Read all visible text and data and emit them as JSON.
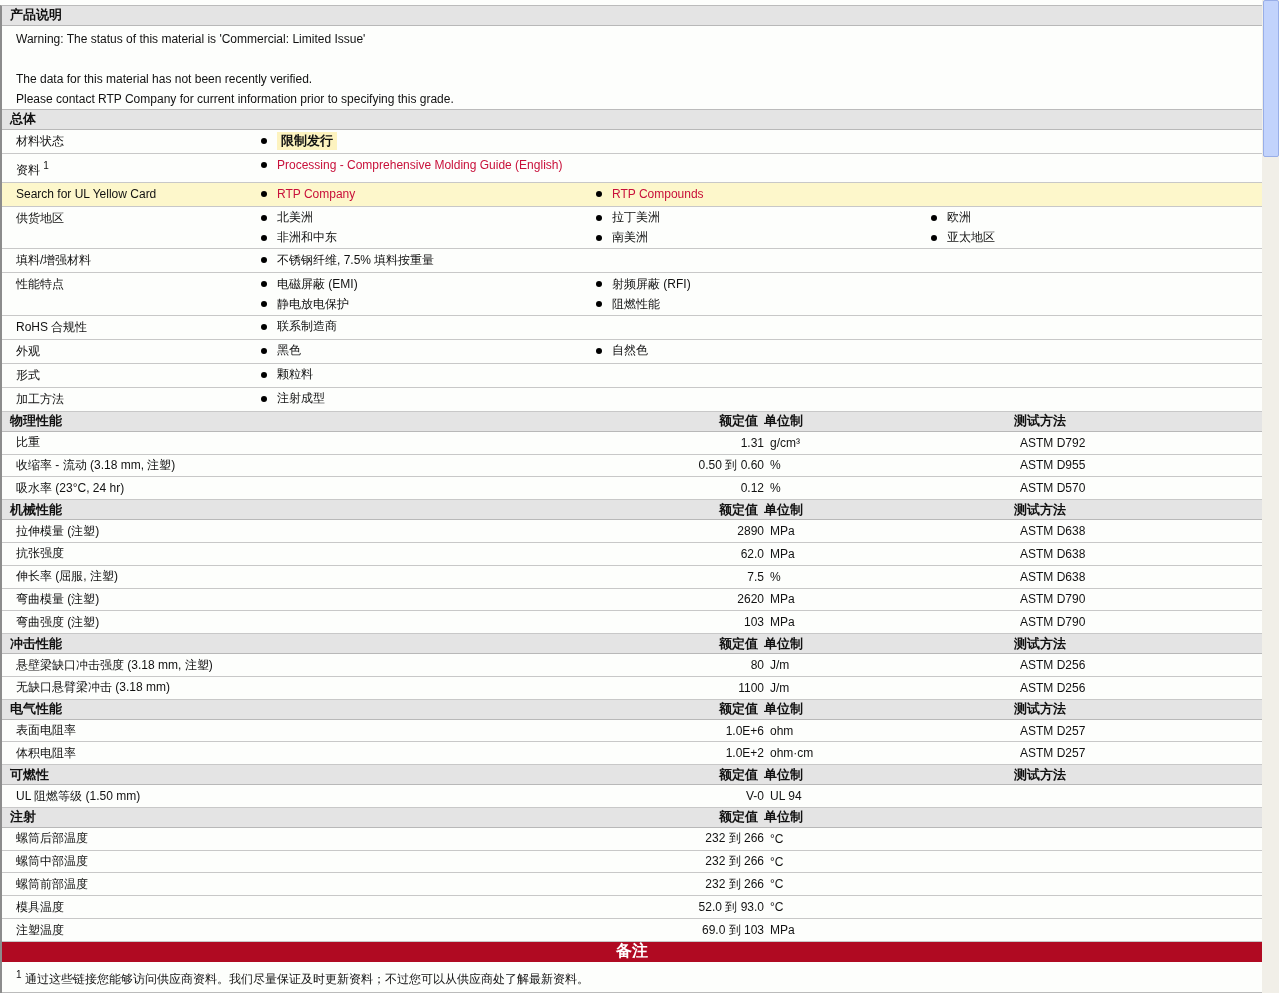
{
  "description": {
    "title": "产品说明",
    "paragraphs": [
      [
        "Warning: The status of this material is 'Commercial: Limited Issue'"
      ],
      [
        "The data for this material has not been recently verified.",
        "Please contact RTP Company for current information prior to specifying this grade."
      ]
    ]
  },
  "general": {
    "title": "总体",
    "rows": [
      {
        "label": "材料状态",
        "highlighted": false,
        "items": [
          {
            "kind": "status",
            "text": "限制发行"
          }
        ]
      },
      {
        "label": "资料 $^{1}$",
        "highlighted": false,
        "items": [
          {
            "kind": "link",
            "text": "Processing - Comprehensive Molding Guide (English)"
          }
        ]
      },
      {
        "label": "Search for UL Yellow Card",
        "highlighted": true,
        "items": [
          {
            "kind": "link",
            "text": "RTP Company"
          },
          {
            "kind": "link",
            "text": "RTP Compounds"
          }
        ]
      },
      {
        "label": "供货地区",
        "highlighted": false,
        "items": [
          {
            "kind": "text",
            "text": "北美洲"
          },
          {
            "kind": "text",
            "text": "拉丁美洲"
          },
          {
            "kind": "text",
            "text": "欧洲"
          },
          {
            "kind": "text",
            "text": "非洲和中东"
          },
          {
            "kind": "text",
            "text": "南美洲"
          },
          {
            "kind": "text",
            "text": "亚太地区"
          }
        ]
      },
      {
        "label": "填料/增强材料",
        "highlighted": false,
        "items": [
          {
            "kind": "text",
            "text": "不锈钢纤维, 7.5% 填料按重量"
          }
        ]
      },
      {
        "label": "性能特点",
        "highlighted": false,
        "items": [
          {
            "kind": "text",
            "text": "电磁屏蔽 (EMI)"
          },
          {
            "kind": "text",
            "text": "射频屏蔽 (RFI)"
          },
          {
            "kind": "break"
          },
          {
            "kind": "text",
            "text": "静电放电保护"
          },
          {
            "kind": "text",
            "text": "阻燃性能"
          }
        ]
      },
      {
        "label": "RoHS 合规性",
        "highlighted": false,
        "items": [
          {
            "kind": "text",
            "text": "联系制造商"
          }
        ]
      },
      {
        "label": "外观",
        "highlighted": false,
        "items": [
          {
            "kind": "text",
            "text": "黑色"
          },
          {
            "kind": "text",
            "text": "自然色"
          }
        ]
      },
      {
        "label": "形式",
        "highlighted": false,
        "items": [
          {
            "kind": "text",
            "text": "颗粒料"
          }
        ]
      },
      {
        "label": "加工方法",
        "highlighted": false,
        "items": [
          {
            "kind": "text",
            "text": "注射成型"
          }
        ]
      }
    ]
  },
  "property_sections": [
    {
      "title": "物理性能",
      "headers": {
        "value": "额定值",
        "unit": "单位制",
        "method": "测试方法"
      },
      "rows": [
        {
          "name": "比重",
          "value": "1.31",
          "unit": "g/cm³",
          "method": "ASTM D792"
        },
        {
          "name": "收缩率  - 流动 (3.18 mm, 注塑)",
          "value": "0.50 到  0.60",
          "unit": "%",
          "method": "ASTM D955"
        },
        {
          "name": "吸水率 (23°C, 24 hr)",
          "value": "0.12",
          "unit": "%",
          "method": "ASTM D570"
        }
      ]
    },
    {
      "title": "机械性能",
      "headers": {
        "value": "额定值",
        "unit": "单位制",
        "method": "测试方法"
      },
      "rows": [
        {
          "name": "拉伸模量 (注塑)",
          "value": "2890",
          "unit": "MPa",
          "method": "ASTM D638"
        },
        {
          "name": "抗张强度",
          "value": "62.0",
          "unit": "MPa",
          "method": "ASTM D638"
        },
        {
          "name": "伸长率 (屈服, 注塑)",
          "value": "7.5",
          "unit": "%",
          "method": "ASTM D638"
        },
        {
          "name": "弯曲模量 (注塑)",
          "value": "2620",
          "unit": "MPa",
          "method": "ASTM D790"
        },
        {
          "name": "弯曲强度 (注塑)",
          "value": "103",
          "unit": "MPa",
          "method": "ASTM D790"
        }
      ]
    },
    {
      "title": "冲击性能",
      "headers": {
        "value": "额定值",
        "unit": "单位制",
        "method": "测试方法"
      },
      "rows": [
        {
          "name": "悬壁梁缺口冲击强度 (3.18 mm, 注塑)",
          "value": "80",
          "unit": "J/m",
          "method": "ASTM D256"
        },
        {
          "name": "无缺口悬臂梁冲击 (3.18 mm)",
          "value": "1100",
          "unit": "J/m",
          "method": "ASTM D256"
        }
      ]
    },
    {
      "title": "电气性能",
      "headers": {
        "value": "额定值",
        "unit": "单位制",
        "method": "测试方法"
      },
      "rows": [
        {
          "name": "表面电阻率",
          "value": "1.0E+6",
          "unit": "ohm",
          "method": "ASTM D257"
        },
        {
          "name": "体积电阻率",
          "value": "1.0E+2",
          "unit": "ohm·cm",
          "method": "ASTM D257"
        }
      ]
    },
    {
      "title": "可燃性",
      "headers": {
        "value": "额定值",
        "unit": "单位制",
        "method": "测试方法"
      },
      "rows": [
        {
          "name": "UL 阻燃等级 (1.50 mm)",
          "value": "V-0",
          "method": "UL 94"
        }
      ]
    },
    {
      "title": "注射",
      "headers": {
        "value": "额定值",
        "unit": "单位制"
      },
      "rows": [
        {
          "name": "螺筒后部温度",
          "value": "232 到  266",
          "unit": "°C"
        },
        {
          "name": "螺筒中部温度",
          "value": "232 到  266",
          "unit": "°C"
        },
        {
          "name": "螺筒前部温度",
          "value": "232 到  266",
          "unit": "°C"
        },
        {
          "name": "模具温度",
          "value": "52.0 到  93.0",
          "unit": "°C"
        },
        {
          "name": "注塑温度",
          "value": "69.0 到  103",
          "unit": "MPa"
        }
      ]
    }
  ],
  "notes": {
    "title": "备注",
    "footnotes": [
      {
        "text": "$^{1}$ 通过这些链接您能够访问供应商资料。我们尽量保证及时更新资料；不过您可以从供应商处了解最新资料。"
      }
    ]
  }
}
